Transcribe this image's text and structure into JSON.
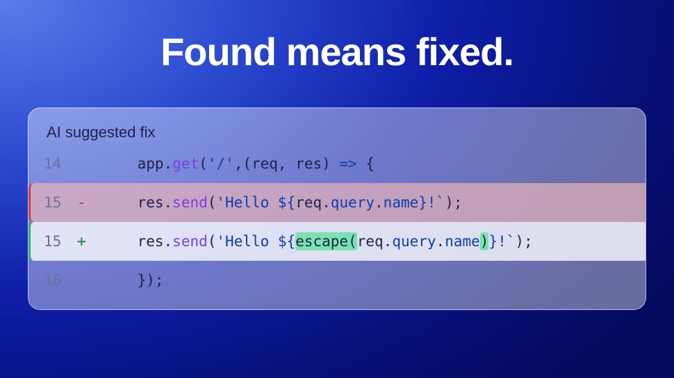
{
  "headline": "Found means fixed.",
  "card": {
    "title": "AI suggested fix"
  },
  "code": {
    "lines": [
      {
        "n": "14",
        "kind": "ctx",
        "marker": "",
        "indent": "    ",
        "tokens": [
          {
            "t": "app",
            "c": "tok-punc"
          },
          {
            "t": ".",
            "c": "tok-punc"
          },
          {
            "t": "get",
            "c": "tok-method"
          },
          {
            "t": "(",
            "c": "tok-punc"
          },
          {
            "t": "'/'",
            "c": "tok-string"
          },
          {
            "t": ",(req, res) ",
            "c": "tok-punc"
          },
          {
            "t": "=>",
            "c": "tok-prop"
          },
          {
            "t": " {",
            "c": "tok-punc"
          }
        ]
      },
      {
        "n": "15",
        "kind": "deleted",
        "marker": "-",
        "indent": "    ",
        "tokens": [
          {
            "t": "res",
            "c": "tok-punc"
          },
          {
            "t": ".",
            "c": "tok-punc"
          },
          {
            "t": "send",
            "c": "tok-method"
          },
          {
            "t": "(",
            "c": "tok-punc"
          },
          {
            "t": "'Hello ${",
            "c": "tok-string"
          },
          {
            "t": "req",
            "c": "tok-punc"
          },
          {
            "t": ".",
            "c": "tok-punc"
          },
          {
            "t": "query",
            "c": "tok-prop"
          },
          {
            "t": ".",
            "c": "tok-punc"
          },
          {
            "t": "name",
            "c": "tok-prop"
          },
          {
            "t": "}!`",
            "c": "tok-string"
          },
          {
            "t": ");",
            "c": "tok-punc"
          }
        ]
      },
      {
        "n": "15",
        "kind": "added",
        "marker": "+",
        "indent": "    ",
        "tokens": [
          {
            "t": "res",
            "c": "tok-punc"
          },
          {
            "t": ".",
            "c": "tok-punc"
          },
          {
            "t": "send",
            "c": "tok-method"
          },
          {
            "t": "(",
            "c": "tok-punc"
          },
          {
            "t": "'Hello ${",
            "c": "tok-string"
          },
          {
            "t": "escape(",
            "c": "tok-punc",
            "hl": true
          },
          {
            "t": "req",
            "c": "tok-punc"
          },
          {
            "t": ".",
            "c": "tok-punc"
          },
          {
            "t": "query",
            "c": "tok-prop"
          },
          {
            "t": ".",
            "c": "tok-punc"
          },
          {
            "t": "name",
            "c": "tok-prop"
          },
          {
            "t": ")",
            "c": "tok-punc",
            "hl": true
          },
          {
            "t": "}!`",
            "c": "tok-string"
          },
          {
            "t": ");",
            "c": "tok-punc"
          }
        ]
      },
      {
        "n": "16",
        "kind": "ctx",
        "marker": "",
        "indent": "    ",
        "tokens": [
          {
            "t": "});",
            "c": "tok-punc"
          }
        ]
      }
    ]
  }
}
